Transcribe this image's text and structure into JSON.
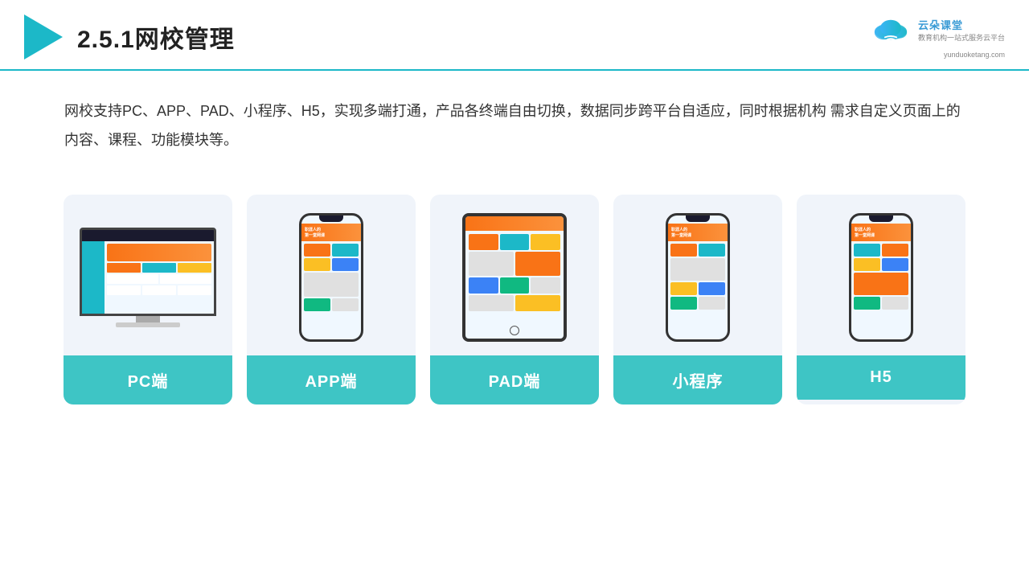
{
  "header": {
    "title": "2.5.1网校管理",
    "brand": {
      "name": "云朵课堂",
      "url": "yunduoketang.com",
      "slogan": "教育机构一站\n式服务云平台"
    }
  },
  "description": "网校支持PC、APP、PAD、小程序、H5，实现多端打通，产品各终端自由切换，数据同步跨平台自适应，同时根据机构\n需求自定义页面上的内容、课程、功能模块等。",
  "cards": [
    {
      "id": "pc",
      "label": "PC端",
      "type": "pc"
    },
    {
      "id": "app",
      "label": "APP端",
      "type": "phone"
    },
    {
      "id": "pad",
      "label": "PAD端",
      "type": "tablet"
    },
    {
      "id": "miniprogram",
      "label": "小程序",
      "type": "phone"
    },
    {
      "id": "h5",
      "label": "H5",
      "type": "phone"
    }
  ],
  "colors": {
    "accent": "#1cb8c8",
    "card_bg": "#eef3fa",
    "label_bg": "#3ec5c5",
    "header_border": "#1cb8c8"
  }
}
